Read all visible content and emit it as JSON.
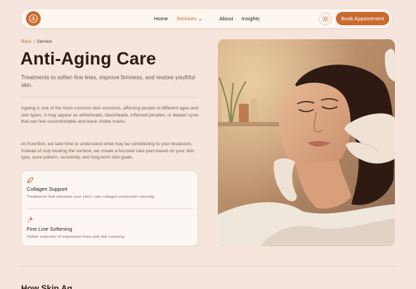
{
  "nav": {
    "links": [
      "Home",
      "Services",
      "About",
      "Insights"
    ],
    "active": "Services",
    "book_label": "Book Appointment"
  },
  "breadcrumb": {
    "back": "Back",
    "separator": "/",
    "current": "Service"
  },
  "page": {
    "title": "Anti-Aging Care",
    "subtitle": "Treatments to soften fine lines, improve firmness, and restore youthful skin.",
    "paragraph1": "Ageing is one of the most common skin concerns, affecting people of different ages and skin types. It may appear as whiteheads, blackheads, inflamed pimples, or deeper cysts that can feel uncomfortable and leave visible marks.",
    "paragraph2": "At PureSkin, we take time to understand what may be contributing to your breakouts. Instead of only treating the surface, we create a focused care plan based on your skin type, acne pattern, sensitivity, and long-term skin goals."
  },
  "features": [
    {
      "icon": "leaf-icon",
      "title": "Collagen Support",
      "desc": "Treatments that stimulate your skin's own collagen production naturally."
    },
    {
      "icon": "sparkle-icon",
      "title": "Fine Line Softening",
      "desc": "Visible reduction of expression lines and skin creasing."
    }
  ],
  "next_section": {
    "title": "How Skin Ag"
  },
  "colors": {
    "accent": "#c96a2f",
    "background": "#f6e5dc"
  }
}
